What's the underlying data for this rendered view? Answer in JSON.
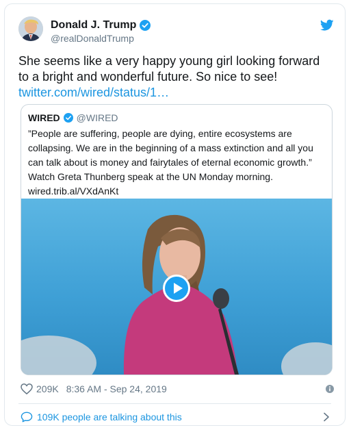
{
  "author": {
    "name": "Donald J. Trump",
    "handle": "@realDonaldTrump",
    "verified": true,
    "avatar_icon": "avatar-portrait-icon"
  },
  "tweet": {
    "text": "She seems like a very happy young girl looking forward to a bright and wonderful future. So nice to see!",
    "link": "twitter.com/wired/status/1…"
  },
  "quoted_tweet": {
    "name": "WIRED",
    "handle": "@WIRED",
    "verified": true,
    "lines": [
      "”People are suffering, people are dying, entire ecosystems are",
      "collapsing. We are in the beginning of a mass extinction and all you",
      "can talk about is money and fairytales of eternal economic growth.”",
      "Watch Greta Thunberg speak at the UN Monday morning.",
      "wired.trib.al/VXdAnKt"
    ],
    "media": {
      "type": "video",
      "play_icon": "play-icon"
    }
  },
  "meta": {
    "likes": "209K",
    "timestamp": "8:36 AM - Sep 24, 2019"
  },
  "footer": {
    "talking": "109K people are talking about this"
  },
  "colors": {
    "accent": "#1da1f2",
    "link": "#1b95e0",
    "muted": "#657786",
    "border": "#e1e8ed"
  }
}
